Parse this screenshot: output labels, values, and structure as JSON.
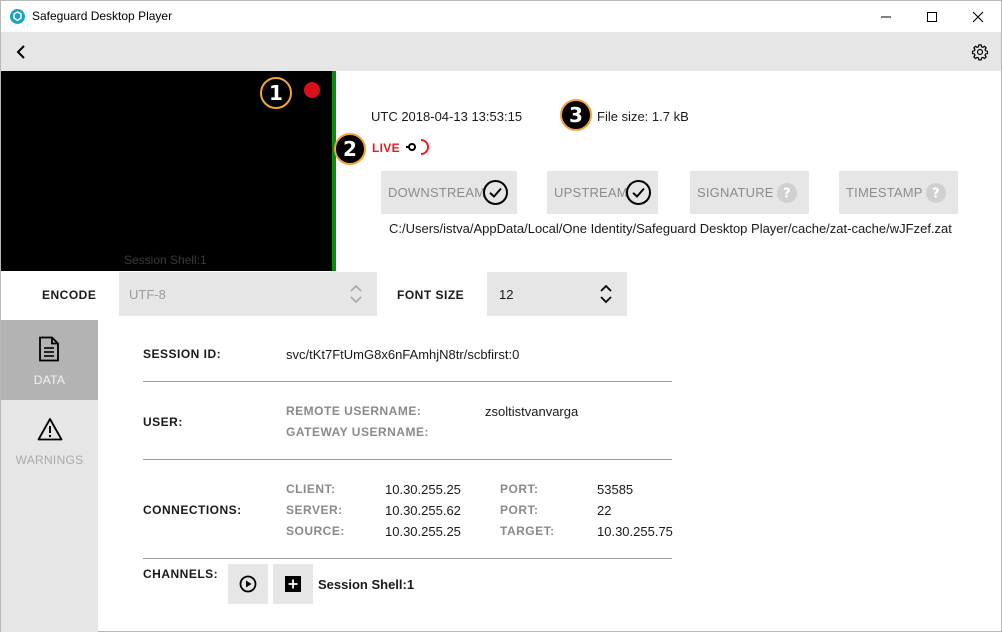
{
  "window": {
    "title": "Safeguard Desktop Player"
  },
  "video": {
    "channel_label": "Session Shell:1"
  },
  "markers": [
    "1",
    "2",
    "3"
  ],
  "info": {
    "utc": "UTC 2018-04-13 13:53:15",
    "file_size": "File size: 1.7 kB",
    "live": "LIVE"
  },
  "status_buttons": [
    {
      "label": "DOWNSTREAM",
      "icon": "check-circle-icon"
    },
    {
      "label": "UPSTREAM",
      "icon": "check-circle-icon"
    },
    {
      "label": "SIGNATURE",
      "icon": "question-circle-icon"
    },
    {
      "label": "TIMESTAMP",
      "icon": "question-circle-icon"
    }
  ],
  "path": "C:/Users/istva/AppData/Local/One Identity/Safeguard Desktop Player/cache/zat-cache/wJFzef.zat",
  "encode": {
    "label": "ENCODE",
    "value": "UTF-8"
  },
  "font_size": {
    "label": "FONT SIZE",
    "value": "12"
  },
  "nav": [
    {
      "label": "DATA",
      "icon": "document-icon",
      "active": true
    },
    {
      "label": "WARNINGS",
      "icon": "warning-icon",
      "active": false
    }
  ],
  "details": {
    "session_id_label": "SESSION ID:",
    "session_id": "svc/tKt7FtUmG8x6nFAmhjN8tr/scbfirst:0",
    "user_label": "USER:",
    "remote_username_label": "REMOTE USERNAME:",
    "remote_username": "zsoltistvanvarga",
    "gateway_username_label": "GATEWAY USERNAME:",
    "gateway_username": "",
    "connections_label": "CONNECTIONS:",
    "client_label": "CLIENT:",
    "client": "10.30.255.25",
    "client_port_label": "PORT:",
    "client_port": "53585",
    "server_label": "SERVER:",
    "server": "10.30.255.62",
    "server_port_label": "PORT:",
    "server_port": "22",
    "source_label": "SOURCE:",
    "source": "10.30.255.25",
    "target_label": "TARGET:",
    "target": "10.30.255.75",
    "channels_label": "CHANNELS:",
    "channel_name": "Session Shell:1"
  },
  "colors": {
    "accent_green": "#0c8a0c",
    "live_red": "#e51d1d",
    "marker_border": "#f5a23a",
    "panel_gray": "#e6e6e6",
    "app_icon": "#1aa3c8"
  }
}
